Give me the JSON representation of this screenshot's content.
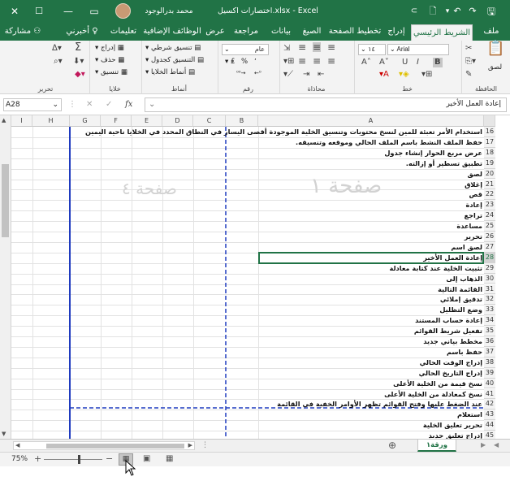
{
  "titlebar": {
    "close": "✕",
    "restore": "☐",
    "minimize": "—",
    "ribbon_display": "▭",
    "user_name": "محمد بدرالوجود",
    "doc_title": "اختصارات اكسيل.xlsx  -  Excel",
    "touch_mode": "⊂",
    "new_doc": "🗋",
    "undo": "↶",
    "redo": "↷",
    "qat_more": "▾",
    "save": "🖫"
  },
  "tabs": {
    "share": "مشاركة",
    "tell_me": "أخبرني",
    "help": "تعليمات",
    "addins": "الوظائف الإضافية",
    "view": "عرض",
    "review": "مراجعة",
    "data": "بيانات",
    "formulas": "الصيغ",
    "page_layout": "تخطيط الصفحة",
    "insert": "إدراج",
    "home": "الشريط الرئيسي",
    "file": "ملف"
  },
  "ribbon": {
    "editing_label": "تحرير",
    "cells_label": "خلايا",
    "styles_label": "أنماط",
    "number_label": "رقم",
    "alignment_label": "محاذاة",
    "font_label": "خط",
    "clipboard_label": "الحافظة",
    "insert_btn": "إدراج",
    "delete_btn": "حذف",
    "format_btn": "تنسيق",
    "conditional_fmt": "تنسيق شرطي",
    "format_table": "التنسيق كجدول",
    "cell_styles": "أنماط الخلايا",
    "number_format": "عام",
    "font_name": "Arial",
    "font_size": "١٤",
    "paste_label": "لصق",
    "percent": "%",
    "comma": "٬",
    "bold": "B",
    "italic": "I",
    "underline": "U"
  },
  "formula_bar": {
    "name_box": "A28",
    "fx": "fx",
    "value": "إعادة العمل الأخير"
  },
  "columns": [
    "A",
    "B",
    "C",
    "D",
    "E",
    "F",
    "G",
    "H",
    "I"
  ],
  "page_watermarks": {
    "page1": "صفحة ١",
    "page2": "صفحة ٤"
  },
  "rows": [
    {
      "n": "16",
      "text": "استخدام الأمر تعبئة للمين لنسخ محتويات وتنسيق الخلية الموجودة أقصى اليسار في النطاق المحدد في الخلايا ناحية اليمين"
    },
    {
      "n": "17",
      "text": "حفظ الملف النشط باسم الملف الحالي وموقعه وتنسيقه."
    },
    {
      "n": "18",
      "text": "عرض مربع الحوار إنشاء جدول"
    },
    {
      "n": "19",
      "text": "تطبيق تسطير أو إزالته."
    },
    {
      "n": "20",
      "text": "لصق"
    },
    {
      "n": "21",
      "text": "إغلاق"
    },
    {
      "n": "22",
      "text": "قص"
    },
    {
      "n": "23",
      "text": "إعادة"
    },
    {
      "n": "24",
      "text": "تراجع"
    },
    {
      "n": "25",
      "text": "مساعدة"
    },
    {
      "n": "26",
      "text": "تحرير"
    },
    {
      "n": "27",
      "text": "لصق اسم"
    },
    {
      "n": "28",
      "text": "إعادة العمل الأخير"
    },
    {
      "n": "29",
      "text": "تثبيت الخلية عند كتابة معادلة"
    },
    {
      "n": "30",
      "text": "الذهاب إلى"
    },
    {
      "n": "31",
      "text": "القائمة التالية"
    },
    {
      "n": "32",
      "text": "تدقيق إملائي"
    },
    {
      "n": "33",
      "text": "وضع التظليل"
    },
    {
      "n": "34",
      "text": "إعادة حساب المستند"
    },
    {
      "n": "35",
      "text": "تفعيل شريط القوائم"
    },
    {
      "n": "36",
      "text": "مخطط بياني جديد"
    },
    {
      "n": "37",
      "text": "حفظ باسم"
    },
    {
      "n": "38",
      "text": "إدراج الوقت الحالي"
    },
    {
      "n": "39",
      "text": "إدراج التاريخ الحالي"
    },
    {
      "n": "40",
      "text": "نسخ قيمة من الخلية الأعلى"
    },
    {
      "n": "41",
      "text": "نسخ كمعادلة من الخلية الأعلى"
    },
    {
      "n": "42",
      "text": "عند الضغط عليها وفتح القوائم تظهر الأوامر الخفية في القائمة"
    },
    {
      "n": "43",
      "text": "استعلام"
    },
    {
      "n": "44",
      "text": "تحرير تعليق الخلية"
    },
    {
      "n": "45",
      "text": "إدراج تعليق جديد"
    }
  ],
  "sheet_tabs": {
    "sheet1": "ورقة١",
    "add_sheet": "⊕"
  },
  "statusbar": {
    "zoom": "75%",
    "zoom_minus": "−",
    "zoom_plus": "+"
  }
}
